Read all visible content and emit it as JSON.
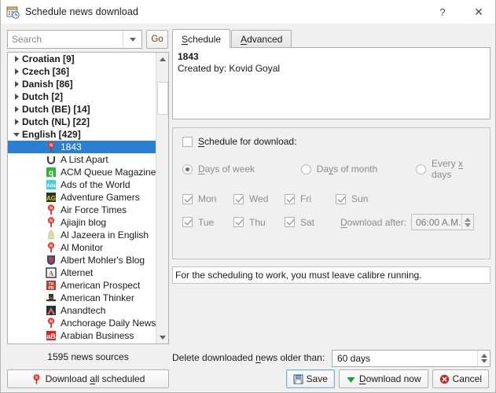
{
  "window": {
    "title": "Schedule news download",
    "icon": "calendar-clock-icon",
    "help_label": "?",
    "close_label": "✕"
  },
  "search": {
    "placeholder": "Search",
    "value": "",
    "dropdown_icon": "chevron-down-icon",
    "go_label": "Go"
  },
  "tree": {
    "groups": [
      {
        "label": "Croatian [9]",
        "expanded": false
      },
      {
        "label": "Czech [36]",
        "expanded": false
      },
      {
        "label": "Danish [86]",
        "expanded": false
      },
      {
        "label": "Dutch [2]",
        "expanded": false
      },
      {
        "label": "Dutch (BE) [14]",
        "expanded": false
      },
      {
        "label": "Dutch (NL) [22]",
        "expanded": false
      },
      {
        "label": "English [429]",
        "expanded": true
      }
    ],
    "items": [
      {
        "label": "1843",
        "icon": "pin",
        "selected": true
      },
      {
        "label": "A List Apart",
        "icon": "alistapart",
        "selected": false
      },
      {
        "label": "ACM Queue Magazine",
        "icon": "acmqueue",
        "selected": false
      },
      {
        "label": "Ads of the World",
        "icon": "adsoftheworld",
        "selected": false
      },
      {
        "label": "Adventure Gamers",
        "icon": "adventuregamers",
        "selected": false
      },
      {
        "label": "Air Force Times",
        "icon": "pin",
        "selected": false
      },
      {
        "label": "Ajiajin blog",
        "icon": "pin",
        "selected": false
      },
      {
        "label": "Al Jazeera in English",
        "icon": "aljazeera",
        "selected": false
      },
      {
        "label": "Al Monitor",
        "icon": "pin",
        "selected": false
      },
      {
        "label": "Albert Mohler's Blog",
        "icon": "albertmohler",
        "selected": false
      },
      {
        "label": "Alternet",
        "icon": "alternet",
        "selected": false
      },
      {
        "label": "American Prospect",
        "icon": "americanprospect",
        "selected": false
      },
      {
        "label": "American Thinker",
        "icon": "americanthinker",
        "selected": false
      },
      {
        "label": "Anandtech",
        "icon": "anandtech",
        "selected": false
      },
      {
        "label": "Anchorage Daily News",
        "icon": "pin",
        "selected": false
      },
      {
        "label": "Arabian Business",
        "icon": "arabianbusiness",
        "selected": false
      }
    ],
    "scrollbar": {
      "up_icon": "scroll-up-icon",
      "down_icon": "scroll-down-icon"
    }
  },
  "tabs": [
    {
      "label": "Schedule",
      "accel": "S",
      "active": true
    },
    {
      "label": "Advanced",
      "accel": "A",
      "active": false
    }
  ],
  "description": {
    "title": "1843",
    "created_by": "Created by: Kovid Goyal"
  },
  "schedule": {
    "enable_label": "Schedule for download:",
    "enable_accel": "S",
    "enabled": false,
    "modes": [
      {
        "label": "Days of  week",
        "accel": "D",
        "selected": true
      },
      {
        "label": "Days of month",
        "accel": "y",
        "selected": false
      },
      {
        "label": "Every x days",
        "accel": "x",
        "selected": false
      }
    ],
    "days_row1": [
      {
        "label": "Mon",
        "checked": true
      },
      {
        "label": "Wed",
        "checked": true
      },
      {
        "label": "Fri",
        "checked": true
      },
      {
        "label": "Sun",
        "checked": true
      }
    ],
    "days_row2": [
      {
        "label": "Tue",
        "checked": true
      },
      {
        "label": "Thu",
        "checked": true
      },
      {
        "label": "Sat",
        "checked": true
      }
    ],
    "download_after_label": "Download after:",
    "download_after_accel": "D",
    "download_after_value": "06:00 A.M.",
    "note": "For the scheduling to work, you must leave calibre running."
  },
  "footer": {
    "source_count": "1595 news sources",
    "download_all_label": "Download all scheduled",
    "download_all_accel": "a",
    "download_all_icon": "pin-icon",
    "delete_older_label": "Delete downloaded news older than:",
    "delete_older_accel": "n",
    "delete_older_value": "60 days",
    "buttons": [
      {
        "label": "Save",
        "icon": "floppy-disk-icon",
        "focused": true
      },
      {
        "label": "Download now",
        "accel": "D",
        "icon": "green-down-arrow-icon",
        "focused": false
      },
      {
        "label": "Cancel",
        "icon": "red-x-circle-icon",
        "focused": false
      }
    ]
  },
  "colors": {
    "selection_blue": "#2a7fd4",
    "accent_red": "#e03d2e",
    "green": "#14a03c",
    "focus_border": "#73b2e0"
  }
}
